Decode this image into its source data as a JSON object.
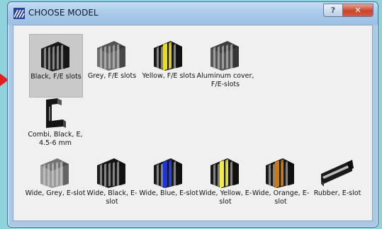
{
  "window": {
    "title": "CHOOSE MODEL",
    "help_label": "?",
    "close_label": "✕"
  },
  "items": [
    {
      "label": "Black, F/E slots",
      "color": "#222222",
      "stripe": null,
      "selected": true
    },
    {
      "label": "Grey, F/E slots",
      "color": "#6e6e6e",
      "stripe": null,
      "selected": false
    },
    {
      "label": "Yellow, F/E slots",
      "color": "#1a1a1a",
      "stripe": "#e8dc2a",
      "selected": false
    },
    {
      "label": "Aluminum cover, F/E-slots",
      "color": "#555555",
      "stripe": null,
      "selected": false
    },
    {
      "label": "Combi, Black, E, 4.5-6 mm",
      "color": "#151515",
      "stripe": null,
      "selected": false
    },
    {
      "label": "Wide, Grey, E-slot",
      "color": "#9a9a9a",
      "stripe": null,
      "selected": false
    },
    {
      "label": "Wide, Black, E-slot",
      "color": "#1c1c1c",
      "stripe": null,
      "selected": false
    },
    {
      "label": "Wide, Blue, E-slot",
      "color": "#1a1a1a",
      "stripe": "#1c34d8",
      "selected": false
    },
    {
      "label": "Wide, Yellow, E-slot",
      "color": "#1a1a1a",
      "stripe": "#f3ec4a",
      "selected": false
    },
    {
      "label": "Wide, Orange, E-slot",
      "color": "#1a1a1a",
      "stripe": "#c97a14",
      "selected": false
    },
    {
      "label": "Rubber, E-slot",
      "color": "#1a1a1a",
      "stripe": null,
      "selected": false
    }
  ]
}
